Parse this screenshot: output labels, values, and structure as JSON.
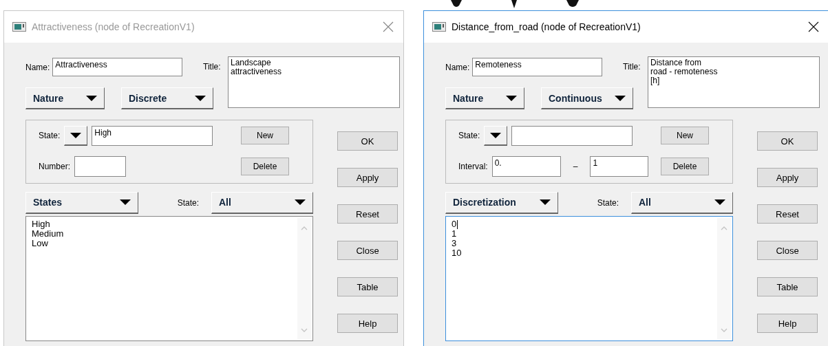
{
  "dialogs": [
    {
      "title": "Attractiveness (node of RecreationV1)",
      "active": false,
      "name_label": "Name:",
      "name_value": "Attractiveness",
      "title_label": "Title:",
      "title_lines": [
        "Landscape",
        "attractiveness"
      ],
      "nature_button": "Nature",
      "type_button": "Discrete",
      "state_label": "State:",
      "state_value": "High",
      "second_row": {
        "kind": "number",
        "label": "Number:"
      },
      "new_button": "New",
      "delete_button": "Delete",
      "list_button": "States",
      "filter_label": "State:",
      "filter_value": "All",
      "list_focused": false,
      "list_items": [
        "High",
        "Medium",
        "Low"
      ],
      "buttons": [
        "OK",
        "Apply",
        "Reset",
        "Close",
        "Table",
        "Help"
      ]
    },
    {
      "title": "Distance_from_road (node of RecreationV1)",
      "active": true,
      "name_label": "Name:",
      "name_value": "Remoteness",
      "title_label": "Title:",
      "title_lines": [
        "Distance from",
        "road - remoteness",
        "[h]"
      ],
      "nature_button": "Nature",
      "type_button": "Continuous",
      "state_label": "State:",
      "second_row": {
        "kind": "interval",
        "label": "Interval:",
        "from": "0.",
        "separator": "–",
        "to": "1"
      },
      "new_button": "New",
      "delete_button": "Delete",
      "list_button": "Discretization",
      "filter_label": "State:",
      "filter_value": "All",
      "list_focused": true,
      "list_items": [
        "0",
        "1",
        "3",
        "10"
      ],
      "buttons": [
        "OK",
        "Apply",
        "Reset",
        "Close",
        "Table",
        "Help"
      ]
    }
  ]
}
